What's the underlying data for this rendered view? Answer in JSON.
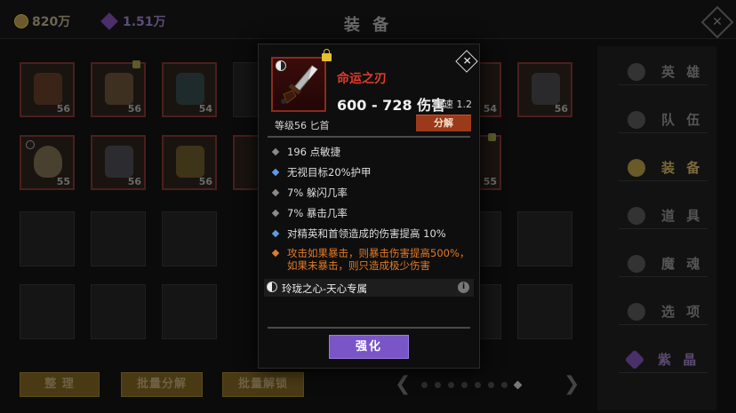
{
  "topbar": {
    "gold": "820万",
    "gems": "1.51万",
    "title": "装 备",
    "close_icon": "close-icon"
  },
  "grid": {
    "row1_levels": [
      "56",
      "56",
      "54",
      "54",
      "56"
    ],
    "row2_levels": [
      "55",
      "56",
      "56",
      "55"
    ]
  },
  "menu": {
    "items": [
      {
        "label": "英 雄",
        "icon": "hero-icon"
      },
      {
        "label": "队 伍",
        "icon": "flag-icon"
      },
      {
        "label": "装 备",
        "icon": "helmet-icon",
        "active": true
      },
      {
        "label": "道 具",
        "icon": "bag-icon"
      },
      {
        "label": "魔 魂",
        "icon": "flame-icon"
      },
      {
        "label": "选 项",
        "icon": "gear-icon"
      },
      {
        "label": "紫 晶",
        "icon": "gem-icon"
      }
    ]
  },
  "bottom": {
    "sort_label": "整 理",
    "bulk_decompose_label": "批量分解",
    "bulk_unlock_label": "批量解锁",
    "page_count": 8,
    "current_page": 8
  },
  "modal": {
    "item_name": "命运之刃",
    "damage": "600 - 728 伤害",
    "speed": "攻速 1.2",
    "type_line": "等级56 匕首",
    "decompose_label": "分解",
    "stats": [
      {
        "text": "196 点敏捷",
        "style": "gray"
      },
      {
        "text": "无视目标20%护甲",
        "style": "blue"
      },
      {
        "text": "7% 躲闪几率",
        "style": "gray"
      },
      {
        "text": "7% 暴击几率",
        "style": "gray"
      },
      {
        "text": "对精英和首领造成的伤害提高 10%",
        "style": "blue"
      },
      {
        "text": "攻击如果暴击，则暴击伤害提高500%，如果未暴击，则只造成极少伤害",
        "style": "orange"
      }
    ],
    "set_label": "玲珑之心-天心专属",
    "strengthen_label": "强化",
    "colors": {
      "name": "#e03a2a",
      "blue_bullet": "#5b9be6",
      "orange": "#e07a2a",
      "strengthen": "#7a55c8"
    }
  }
}
